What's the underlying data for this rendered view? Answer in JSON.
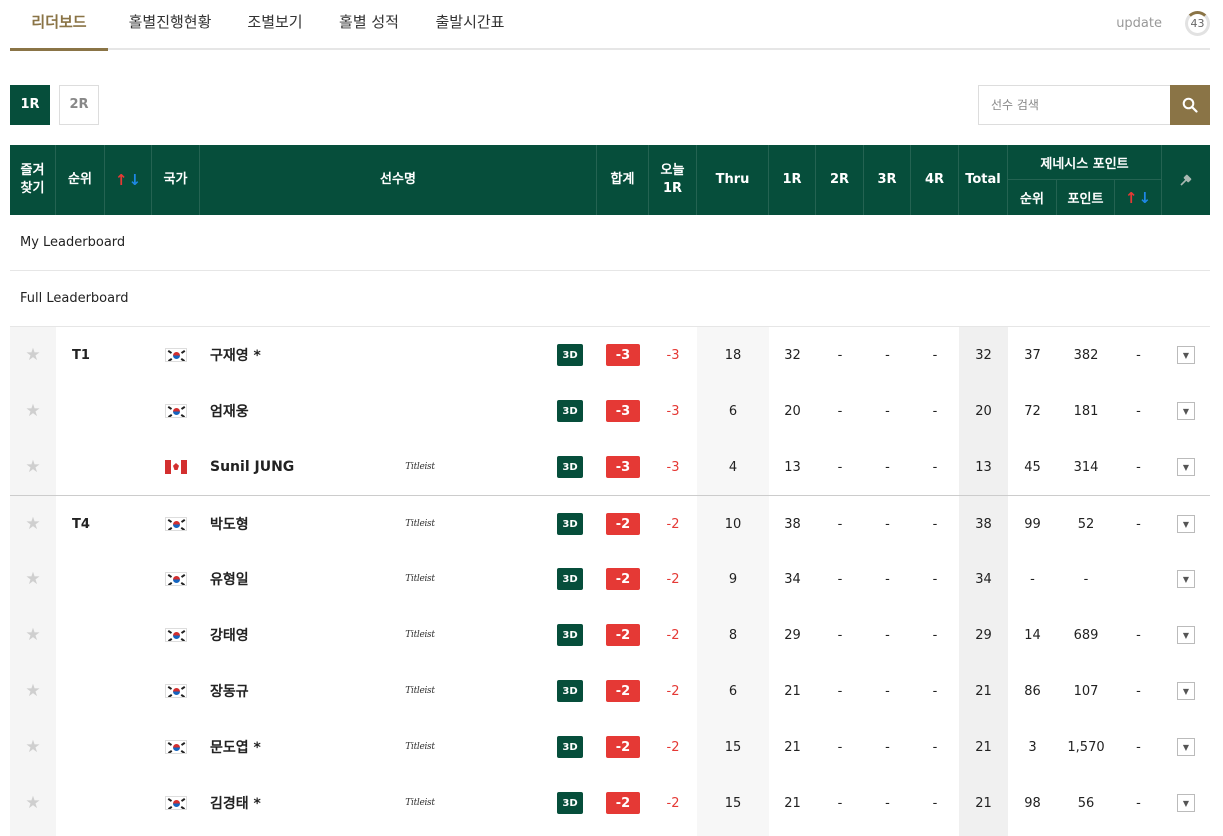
{
  "tabs": [
    {
      "label": "리더보드",
      "active": true
    },
    {
      "label": "홀별진행현황",
      "active": false
    },
    {
      "label": "조별보기",
      "active": false
    },
    {
      "label": "홀별 성적",
      "active": false
    },
    {
      "label": "출발시간표",
      "active": false
    }
  ],
  "update": {
    "label": "update",
    "seconds": "43"
  },
  "rounds": [
    {
      "label": "1R",
      "active": true
    },
    {
      "label": "2R",
      "active": false
    }
  ],
  "search": {
    "placeholder": "선수 검색"
  },
  "header": {
    "favorite": "즐겨\n찾기",
    "rank": "순위",
    "country": "국가",
    "player": "선수명",
    "total": "합계",
    "today": "오늘\n1R",
    "thru": "Thru",
    "r1": "1R",
    "r2": "2R",
    "r3": "3R",
    "r4": "4R",
    "total_strokes": "Total",
    "genesis": "제네시스 포인트",
    "genesis_rank": "순위",
    "genesis_points": "포인트"
  },
  "sections": {
    "my": "My Leaderboard",
    "full": "Full Leaderboard"
  },
  "colors": {
    "primary": "#064e3b",
    "gold": "#8a7446",
    "red": "#e53935"
  },
  "rows": [
    {
      "rank": "T1",
      "flag": "KR",
      "name": "구재영 *",
      "sponsor": "",
      "total": "-3",
      "today": "-3",
      "thru": "18",
      "r1": "32",
      "r2": "-",
      "r3": "-",
      "r4": "-",
      "strokes": "32",
      "g_rank": "37",
      "g_points": "382",
      "g_move": "-",
      "group_top": false
    },
    {
      "rank": "",
      "flag": "KR",
      "name": "엄재웅",
      "sponsor": "",
      "total": "-3",
      "today": "-3",
      "thru": "6",
      "r1": "20",
      "r2": "-",
      "r3": "-",
      "r4": "-",
      "strokes": "20",
      "g_rank": "72",
      "g_points": "181",
      "g_move": "-",
      "group_top": false
    },
    {
      "rank": "",
      "flag": "CA",
      "name": "Sunil JUNG",
      "sponsor": "Titleist",
      "total": "-3",
      "today": "-3",
      "thru": "4",
      "r1": "13",
      "r2": "-",
      "r3": "-",
      "r4": "-",
      "strokes": "13",
      "g_rank": "45",
      "g_points": "314",
      "g_move": "-",
      "group_top": false
    },
    {
      "rank": "T4",
      "flag": "KR",
      "name": "박도형",
      "sponsor": "Titleist",
      "total": "-2",
      "today": "-2",
      "thru": "10",
      "r1": "38",
      "r2": "-",
      "r3": "-",
      "r4": "-",
      "strokes": "38",
      "g_rank": "99",
      "g_points": "52",
      "g_move": "-",
      "group_top": true
    },
    {
      "rank": "",
      "flag": "KR",
      "name": "유형일",
      "sponsor": "Titleist",
      "total": "-2",
      "today": "-2",
      "thru": "9",
      "r1": "34",
      "r2": "-",
      "r3": "-",
      "r4": "-",
      "strokes": "34",
      "g_rank": "-",
      "g_points": "-",
      "g_move": "",
      "group_top": false
    },
    {
      "rank": "",
      "flag": "KR",
      "name": "강태영",
      "sponsor": "Titleist",
      "total": "-2",
      "today": "-2",
      "thru": "8",
      "r1": "29",
      "r2": "-",
      "r3": "-",
      "r4": "-",
      "strokes": "29",
      "g_rank": "14",
      "g_points": "689",
      "g_move": "-",
      "group_top": false
    },
    {
      "rank": "",
      "flag": "KR",
      "name": "장동규",
      "sponsor": "Titleist",
      "total": "-2",
      "today": "-2",
      "thru": "6",
      "r1": "21",
      "r2": "-",
      "r3": "-",
      "r4": "-",
      "strokes": "21",
      "g_rank": "86",
      "g_points": "107",
      "g_move": "-",
      "group_top": false
    },
    {
      "rank": "",
      "flag": "KR",
      "name": "문도엽 *",
      "sponsor": "Titleist",
      "total": "-2",
      "today": "-2",
      "thru": "15",
      "r1": "21",
      "r2": "-",
      "r3": "-",
      "r4": "-",
      "strokes": "21",
      "g_rank": "3",
      "g_points": "1,570",
      "g_move": "-",
      "group_top": false
    },
    {
      "rank": "",
      "flag": "KR",
      "name": "김경태 *",
      "sponsor": "Titleist",
      "total": "-2",
      "today": "-2",
      "thru": "15",
      "r1": "21",
      "r2": "-",
      "r3": "-",
      "r4": "-",
      "strokes": "21",
      "g_rank": "98",
      "g_points": "56",
      "g_move": "-",
      "group_top": false
    }
  ],
  "labels": {
    "btn3d": "3D"
  }
}
